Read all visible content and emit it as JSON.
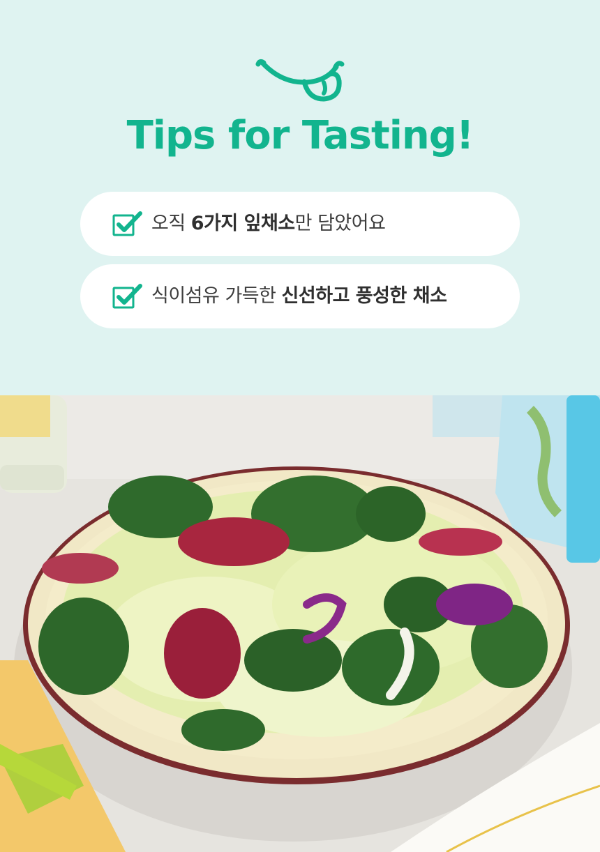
{
  "header": {
    "title": "Tips for Tasting!",
    "icon": "tongue-smile-icon",
    "accent_color": "#12b48e",
    "background_color": "#dff3f1"
  },
  "tips": [
    {
      "icon": "checkbox-checked-icon",
      "parts": [
        {
          "text": "오직 ",
          "bold": false
        },
        {
          "text": "6가지 잎채소",
          "bold": true
        },
        {
          "text": "만 담았어요",
          "bold": false
        }
      ]
    },
    {
      "icon": "checkbox-checked-icon",
      "parts": [
        {
          "text": "식이섬유 가득한 ",
          "bold": false
        },
        {
          "text": "신선하고 풍성한 채소",
          "bold": true
        }
      ]
    }
  ]
}
